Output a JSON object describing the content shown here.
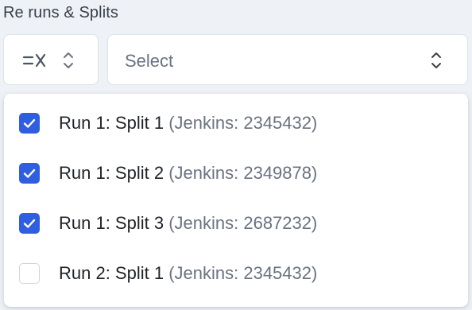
{
  "field": {
    "label": "Re runs & Splits"
  },
  "mode_selector": {
    "icon": "list-filter-x-icon",
    "chevron": "chevron-up-down-icon"
  },
  "select": {
    "placeholder": "Select",
    "chevron": "chevron-up-down-icon"
  },
  "dropdown": {
    "options": [
      {
        "label": "Run 1: Split 1",
        "detail": "(Jenkins: 2345432)",
        "checked": true
      },
      {
        "label": "Run 1: Split 2",
        "detail": "(Jenkins: 2349878)",
        "checked": true
      },
      {
        "label": "Run 1: Split 3",
        "detail": "(Jenkins: 2687232)",
        "checked": true
      },
      {
        "label": "Run 2: Split 1",
        "detail": "(Jenkins: 2345432)",
        "checked": false
      }
    ]
  },
  "colors": {
    "checkbox_checked": "#2f5fe0",
    "text_primary": "#1f2329",
    "text_secondary": "#6b7280",
    "background": "#eef1f5"
  }
}
